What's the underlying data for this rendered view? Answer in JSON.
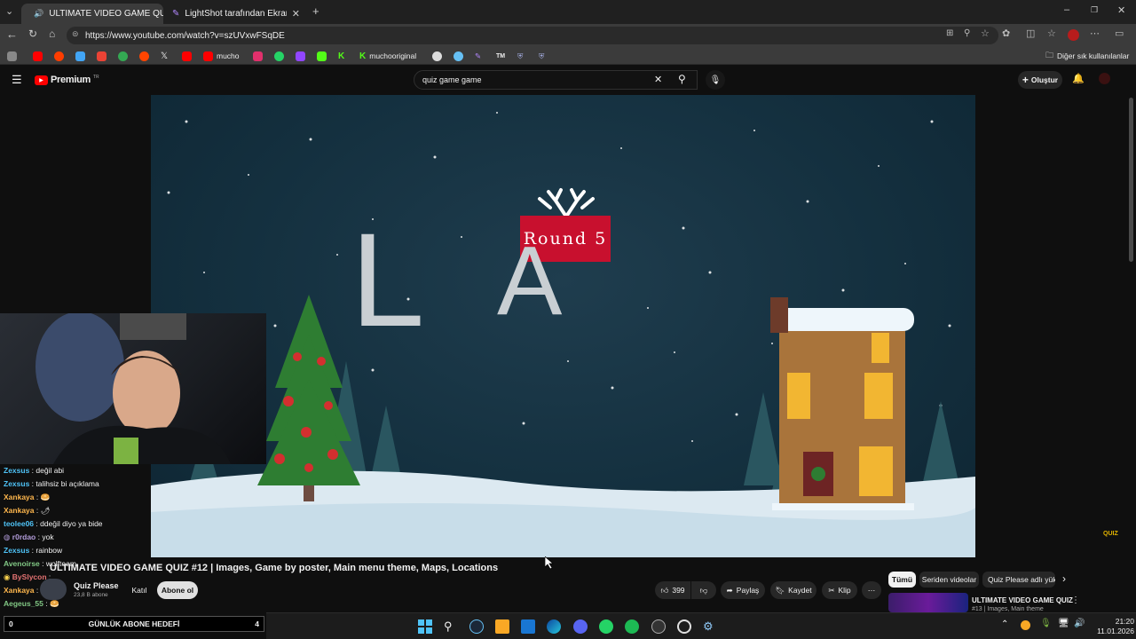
{
  "browser": {
    "tabs": [
      {
        "title": "ULTIMATE VIDEO GAME QUIZ",
        "active": true
      },
      {
        "title": "LightShot tarafından Ekran Görünt",
        "active": false
      }
    ],
    "url": "https://www.youtube.com/watch?v=szUVxwFSqDE",
    "bookmarks": [
      {
        "label": "",
        "icon": "folder-icon"
      },
      {
        "label": "",
        "icon": "chrome-icon"
      },
      {
        "label": "",
        "icon": "reddit-icon"
      },
      {
        "label": "",
        "icon": "x-icon"
      },
      {
        "label": "",
        "icon": "youtube-icon"
      },
      {
        "label": "mucho",
        "icon": "youtube-icon"
      },
      {
        "label": "",
        "icon": "instagram-icon"
      },
      {
        "label": "",
        "icon": "whatsapp-icon"
      },
      {
        "label": "",
        "icon": "twitch-icon"
      },
      {
        "label": "",
        "icon": "kick-icon"
      },
      {
        "label": "",
        "icon": "kick-icon"
      },
      {
        "label": "muchooriginal",
        "icon": "kick-icon"
      },
      {
        "label": "TM",
        "icon": "tm-icon"
      }
    ],
    "other_bookmarks": "Diğer sık kullanılanlar"
  },
  "youtube": {
    "logo": "Premium",
    "logo_region": "TR",
    "search_query": "quiz game game",
    "create_label": "Oluştur"
  },
  "video": {
    "round_label": "Round 5",
    "letters": [
      "L",
      "A"
    ],
    "brand": "QUIZ",
    "title": "ULTIMATE VIDEO GAME QUIZ #12 | Images, Game by poster, Main menu theme, Maps, Locations"
  },
  "channel": {
    "name": "Quiz Please",
    "subs": "23,8 B abone",
    "join_label": "Katıl",
    "subscribe_label": "Abone ol"
  },
  "actions": {
    "likes": "399",
    "share": "Paylaş",
    "save": "Kaydet",
    "clip": "Klip"
  },
  "filter_chips": [
    "Tümü",
    "Seriden videolar",
    "Quiz Please adlı yükle"
  ],
  "recommended": {
    "title": "ULTIMATE VIDEO GAME QUIZ",
    "subtitle": "#13 | Images, Main theme"
  },
  "chat": [
    {
      "user": "Zexsus",
      "color": "#4fc3f7",
      "msg": "değil abi"
    },
    {
      "user": "Zexsus",
      "color": "#4fc3f7",
      "msg": "talihsiz bi açıklama"
    },
    {
      "user": "Xankaya",
      "color": "#ffb74d",
      "msg": "🥯"
    },
    {
      "user": "Xankaya",
      "color": "#ffb74d",
      "msg": "🌶"
    },
    {
      "user": "teolee06",
      "color": "#4fc3f7",
      "msg": "ddeğil diyo ya bide"
    },
    {
      "user": "r0rdao",
      "color": "#b39ddb",
      "msg": "yok"
    },
    {
      "user": "Zexsus",
      "color": "#4fc3f7",
      "msg": "rainbow"
    },
    {
      "user": "Avenoirse",
      "color": "#81c784",
      "msg": "wolfteam"
    },
    {
      "user": "BySlycon",
      "color": "#e57373",
      "msg": ""
    },
    {
      "user": "Xankaya",
      "color": "#ffb74d",
      "msg": ""
    },
    {
      "user": "Aegeus_55",
      "color": "#81c784",
      "msg": "🥯"
    }
  ],
  "goal": {
    "left": "0",
    "label": "GÜNLÜK ABONE HEDEFİ",
    "right": "4"
  },
  "clock": {
    "time": "21:20",
    "date": "11.01.2026"
  }
}
